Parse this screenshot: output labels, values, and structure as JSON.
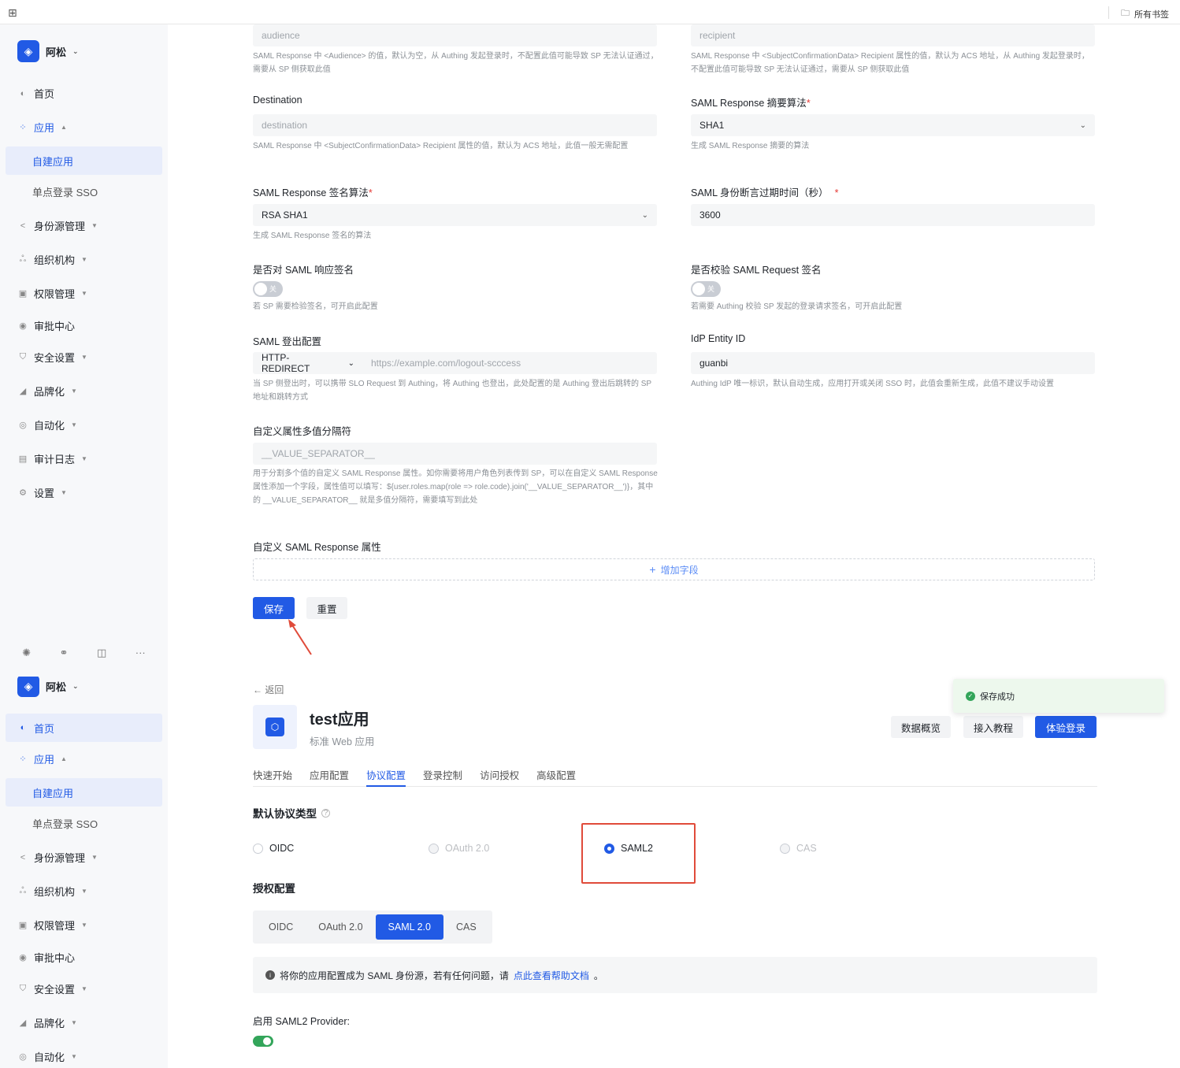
{
  "topbar": {
    "bookmarks_label": "所有书签"
  },
  "sidebar": {
    "workspace": "阿松",
    "items": [
      "首页",
      "应用",
      "自建应用",
      "单点登录 SSO",
      "身份源管理",
      "组织机构",
      "权限管理",
      "审批中心",
      "安全设置",
      "品牌化",
      "自动化",
      "审计日志",
      "设置"
    ]
  },
  "form": {
    "audience_placeholder": "audience",
    "audience_hint": "SAML Response 中 <Audience> 的值，默认为空，从 Authing 发起登录时，不配置此值可能导致 SP 无法认证通过，需要从 SP 侧获取此值",
    "recipient_placeholder": "recipient",
    "recipient_hint": "SAML Response 中 <SubjectConfirmationData> Recipient 属性的值，默认为 ACS 地址，从 Authing 发起登录时，不配置此值可能导致 SP 无法认证通过，需要从 SP 侧获取此值",
    "destination_label": "Destination",
    "destination_placeholder": "destination",
    "destination_hint": "SAML Response 中 <SubjectConfirmationData> Recipient 属性的值，默认为 ACS 地址，此值一般无需配置",
    "digest_label": "SAML Response 摘要算法",
    "digest_value": "SHA1",
    "digest_hint": "生成 SAML Response 摘要的算法",
    "sign_alg_label": "SAML Response 签名算法",
    "sign_alg_value": "RSA SHA1",
    "sign_alg_hint": "生成 SAML Response 签名的算法",
    "expire_label": "SAML 身份断言过期时间（秒）",
    "expire_value": "3600",
    "sign_resp_label": "是否对 SAML 响应签名",
    "sign_resp_toggle": "关",
    "sign_resp_hint": "若 SP 需要检验签名，可开启此配置",
    "verify_req_label": "是否校验 SAML Request 签名",
    "verify_req_toggle": "关",
    "verify_req_hint": "若需要 Authing 校验 SP 发起的登录请求签名，可开启此配置",
    "logout_label": "SAML 登出配置",
    "logout_method": "HTTP-REDIRECT",
    "logout_url_placeholder": "https://example.com/logout-scccess",
    "logout_hint": "当 SP 侧登出时，可以携带 SLO Request 到 Authing，将 Authing 也登出，此处配置的是 Authing 登出后跳转的 SP 地址和跳转方式",
    "entity_label": "IdP Entity ID",
    "entity_value": "guanbi",
    "entity_hint": "Authing IdP 唯一标识，默认自动生成，应用打开或关闭 SSO 时，此值会重新生成，此值不建议手动设置",
    "separator_label": "自定义属性多值分隔符",
    "separator_placeholder": "__VALUE_SEPARATOR__",
    "separator_hint": "用于分割多个值的自定义 SAML Response 属性。如你需要将用户角色列表传到 SP，可以在自定义 SAML Response 属性添加一个字段，属性值可以填写：${user.roles.map(role => role.code).join('__VALUE_SEPARATOR__')}，其中的 __VALUE_SEPARATOR__ 就是多值分隔符，需要填写到此处",
    "custom_attr_label": "自定义 SAML Response 属性",
    "add_field": "增加字段",
    "save": "保存",
    "reset": "重置"
  },
  "app": {
    "back": "返回",
    "name": "test应用",
    "type": "标准 Web 应用",
    "btn_overview": "数据概览",
    "btn_tutorial": "接入教程",
    "btn_try": "体验登录",
    "tabs": [
      "快速开始",
      "应用配置",
      "协议配置",
      "登录控制",
      "访问授权",
      "高级配置"
    ],
    "default_protocol_title": "默认协议类型",
    "protocols": [
      "OIDC",
      "OAuth 2.0",
      "SAML2",
      "CAS"
    ],
    "auth_title": "授权配置",
    "segments": [
      "OIDC",
      "OAuth 2.0",
      "SAML 2.0",
      "CAS"
    ],
    "info_text": "将你的应用配置成为 SAML 身份源，若有任何问题，请",
    "info_link": "点此查看帮助文档",
    "info_end": "。",
    "saml2_provider_label": "启用 SAML2 Provider:"
  },
  "toast": {
    "text": "保存成功"
  },
  "colors": {
    "primary": "#215ae5",
    "success": "#33a55a",
    "annotation": "#e04b3a"
  }
}
